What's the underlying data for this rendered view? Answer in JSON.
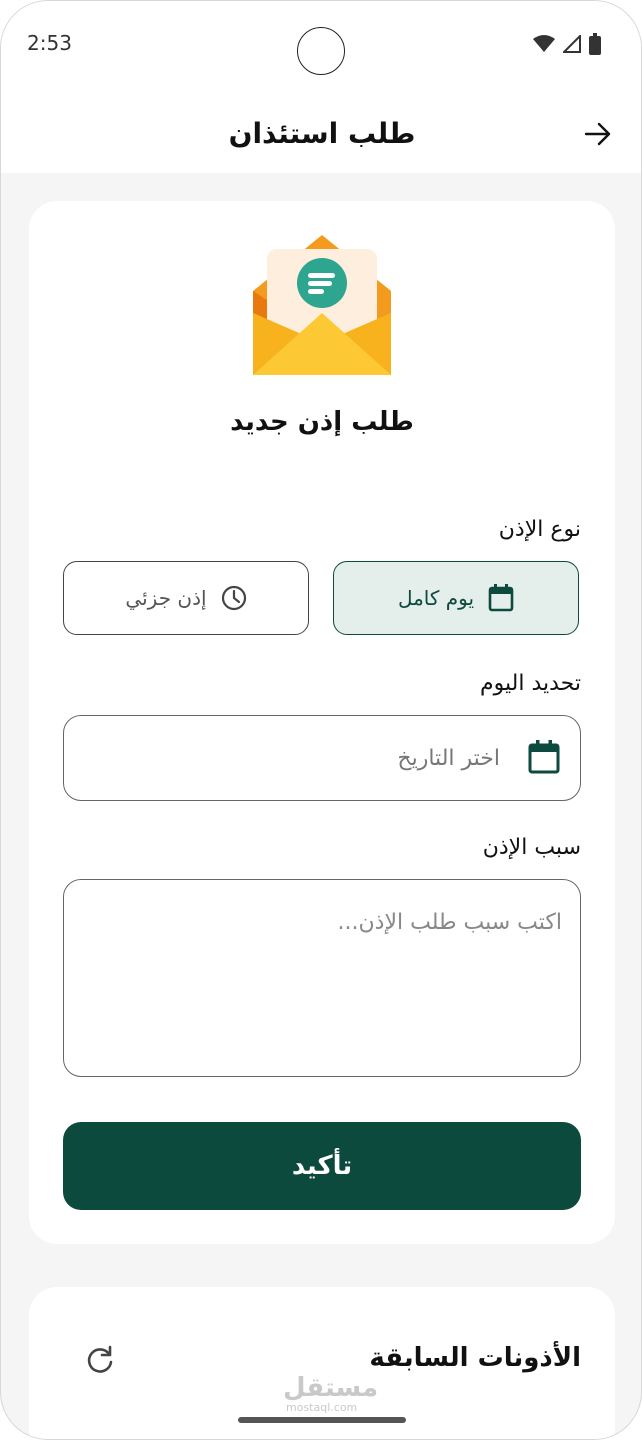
{
  "status_bar": {
    "time": "2:53"
  },
  "app_bar": {
    "title": "طلب استئذان",
    "back_icon": "arrow-right-icon"
  },
  "form": {
    "heading": "طلب إذن جديد",
    "type_label": "نوع الإذن",
    "full_day_label": "يوم كامل",
    "partial_label": "إذن جزئي",
    "selected_type": "يوم كامل",
    "day_label": "تحديد اليوم",
    "date_placeholder": "اختر التاريخ",
    "reason_label": "سبب الإذن",
    "reason_placeholder": "اكتب سبب طلب الإذن...",
    "confirm_label": "تأكيد"
  },
  "previous": {
    "title": "الأذونات السابقة",
    "refresh_icon": "refresh-icon"
  },
  "watermark": {
    "brand": "مستقل",
    "domain": "mostaql.com"
  },
  "colors": {
    "primary": "#0d4a3e",
    "selected_bg": "#e4eeeb",
    "envelope_orange": "#f39a1f",
    "envelope_yellow": "#fcc934",
    "badge_teal": "#2ea58e"
  }
}
